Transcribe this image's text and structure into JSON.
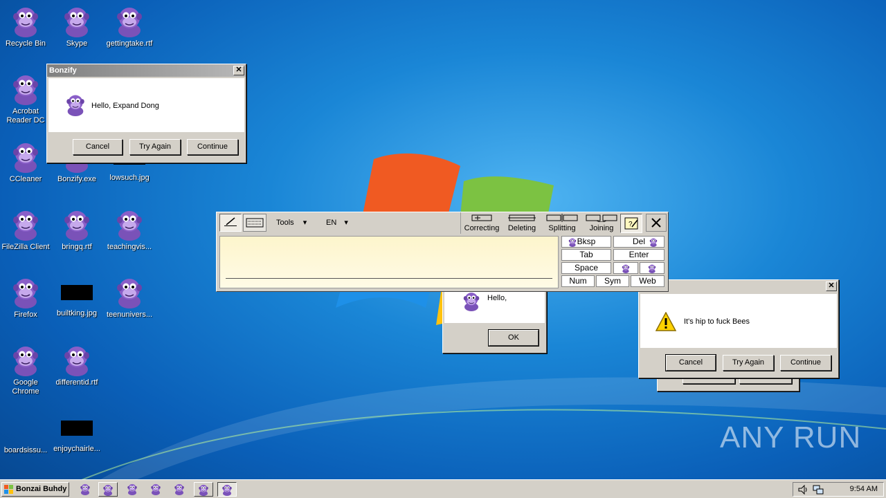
{
  "desktop": {
    "icons": [
      {
        "label": "Recycle Bin",
        "type": "bonzi"
      },
      {
        "label": "Skype",
        "type": "bonzi"
      },
      {
        "label": "gettingtake.rtf",
        "type": "bonzi"
      },
      {
        "label": "Acrobat Reader DC",
        "type": "bonzi"
      },
      {
        "label": "CCleaner",
        "type": "bonzi"
      },
      {
        "label": "Bonzify.exe",
        "type": "bonzi"
      },
      {
        "label": "lowsuch.jpg",
        "type": "black"
      },
      {
        "label": "FileZilla Client",
        "type": "bonzi"
      },
      {
        "label": "bringq.rtf",
        "type": "bonzi"
      },
      {
        "label": "teachingvis...",
        "type": "bonzi"
      },
      {
        "label": "Firefox",
        "type": "bonzi"
      },
      {
        "label": "builtking.jpg",
        "type": "black"
      },
      {
        "label": "teenunivers...",
        "type": "bonzi"
      },
      {
        "label": "Google Chrome",
        "type": "bonzi"
      },
      {
        "label": "differentid.rtf",
        "type": "bonzi"
      },
      {
        "label": "boardsissu...",
        "type": "none"
      },
      {
        "label": "enjoychairle...",
        "type": "black"
      }
    ],
    "watermark": "ANY RUN"
  },
  "bonzify_dialog": {
    "title": "Bonzify",
    "message": "Hello, Expand Dong",
    "buttons": {
      "cancel": "Cancel",
      "try_again": "Try Again",
      "continue": "Continue"
    }
  },
  "hello_dialog": {
    "message": "Hello,",
    "ok": "OK"
  },
  "bees_dialog": {
    "message": "It's hip to fuck Bees",
    "buttons": {
      "cancel": "Cancel",
      "try_again": "Try Again",
      "continue": "Continue"
    }
  },
  "input_panel": {
    "tools_label": "Tools",
    "lang_label": "EN",
    "gestures": [
      "Correcting",
      "Deleting",
      "Splitting",
      "Joining"
    ],
    "keys": {
      "bksp": "Bksp",
      "del": "Del",
      "tab": "Tab",
      "enter": "Enter",
      "space": "Space",
      "num": "Num",
      "sym": "Sym",
      "web": "Web"
    }
  },
  "taskbar": {
    "start_label": "Bonzai Buhdy",
    "clock": "9:54 AM"
  },
  "colors": {
    "purple": "#8a5fc8",
    "purple_dark": "#5b3596",
    "window_face": "#d4d0c8"
  }
}
